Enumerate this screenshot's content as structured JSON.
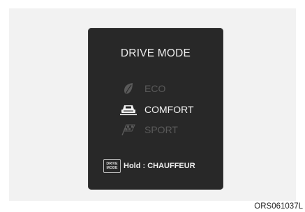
{
  "panel": {
    "title": "DRIVE MODE"
  },
  "modes": [
    {
      "label": "ECO",
      "icon": "leaf-icon",
      "state": "inactive"
    },
    {
      "label": "COMFORT",
      "icon": "car-icon",
      "state": "selected"
    },
    {
      "label": "SPORT",
      "icon": "checkered-flag-icon",
      "state": "inactive"
    }
  ],
  "footer": {
    "key_line1": "DRIVE",
    "key_line2": "MODE",
    "hold_text": "Hold : CHAUFFEUR"
  },
  "figure_code": "ORS061037L",
  "colors": {
    "panel_background": "#282828",
    "active_text": "#f2f2f2",
    "inactive_text": "#5a5a5a"
  }
}
